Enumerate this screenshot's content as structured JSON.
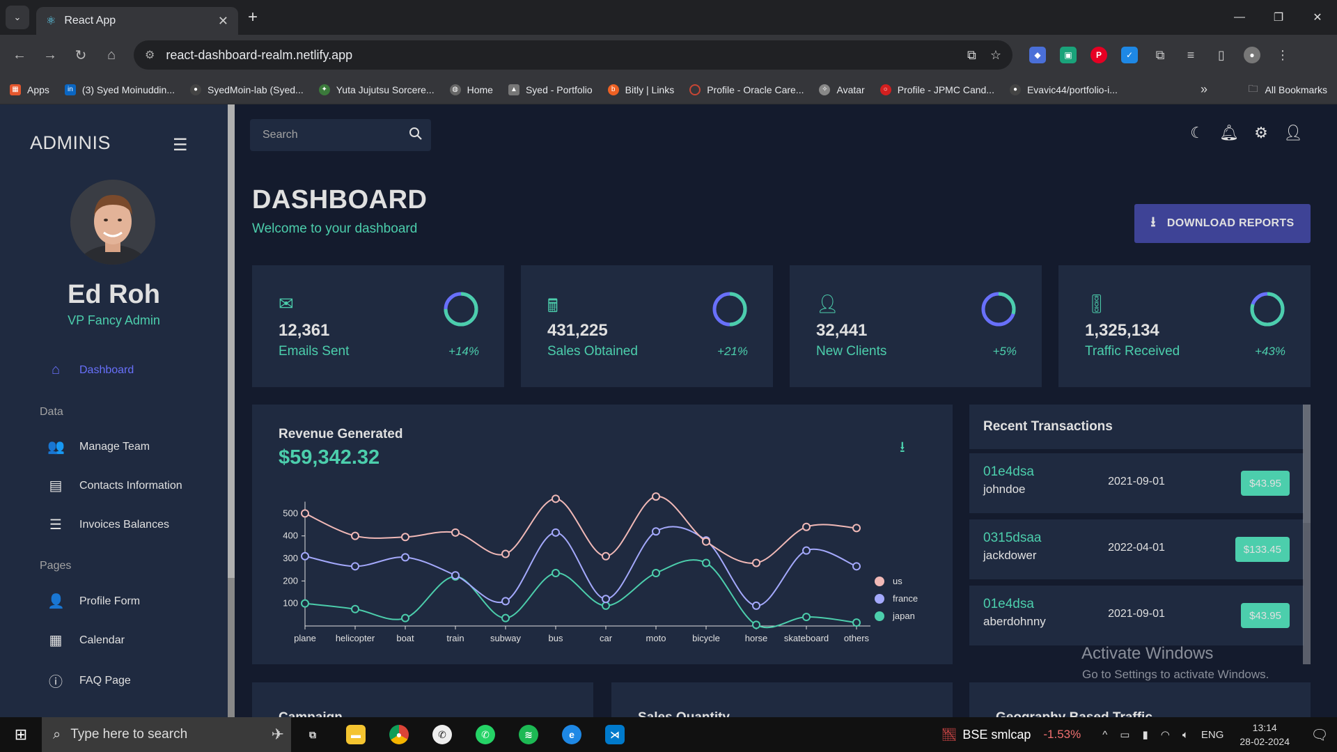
{
  "browser": {
    "tab_title": "React App",
    "url": "react-dashboard-realm.netlify.app",
    "bookmarks": [
      {
        "label": "Apps",
        "color": "#e4572e",
        "icon": "apps-grid-icon"
      },
      {
        "label": "(3) Syed Moinuddin...",
        "color": "#0a66c2",
        "icon": "linkedin-icon"
      },
      {
        "label": "SyedMoin-lab (Syed...",
        "color": "#444444",
        "icon": "github-icon"
      },
      {
        "label": "Yuta Jujutsu Sorcere...",
        "color": "#3b7a3b",
        "icon": "site-icon"
      },
      {
        "label": "Home",
        "color": "#666666",
        "icon": "globe-icon"
      },
      {
        "label": "Syed - Portfolio",
        "color": "#777777",
        "icon": "portfolio-icon"
      },
      {
        "label": "Bitly | Links",
        "color": "#ee6123",
        "icon": "bitly-icon"
      },
      {
        "label": "Profile - Oracle Care...",
        "color": "#c74634",
        "icon": "oracle-icon"
      },
      {
        "label": "Avatar",
        "color": "#888888",
        "icon": "avatar-icon"
      },
      {
        "label": "Profile - JPMC Cand...",
        "color": "#d21f1f",
        "icon": "jpmc-icon"
      },
      {
        "label": "Evavic44/portfolio-i...",
        "color": "#444444",
        "icon": "github-icon"
      }
    ],
    "all_bookmarks": "All Bookmarks"
  },
  "sidebar": {
    "brand": "ADMINIS",
    "user_name": "Ed Roh",
    "user_role": "VP Fancy Admin",
    "items": [
      {
        "label": "Dashboard",
        "icon": "home-icon"
      },
      {
        "section": "Data"
      },
      {
        "label": "Manage Team",
        "icon": "people-icon"
      },
      {
        "label": "Contacts Information",
        "icon": "contacts-icon"
      },
      {
        "label": "Invoices Balances",
        "icon": "receipt-icon"
      },
      {
        "section": "Pages"
      },
      {
        "label": "Profile Form",
        "icon": "person-icon"
      },
      {
        "label": "Calendar",
        "icon": "calendar-icon"
      },
      {
        "label": "FAQ Page",
        "icon": "help-icon"
      }
    ]
  },
  "topbar": {
    "search_placeholder": "Search"
  },
  "header": {
    "title": "DASHBOARD",
    "subtitle": "Welcome to your dashboard",
    "download_label": "DOWNLOAD REPORTS"
  },
  "stats": [
    {
      "value": "12,361",
      "label": "Emails Sent",
      "increase": "+14%",
      "progress": 0.75,
      "icon": "email-icon"
    },
    {
      "value": "431,225",
      "label": "Sales Obtained",
      "increase": "+21%",
      "progress": 0.5,
      "icon": "point-of-sale-icon"
    },
    {
      "value": "32,441",
      "label": "New Clients",
      "increase": "+5%",
      "progress": 0.3,
      "icon": "person-add-icon"
    },
    {
      "value": "1,325,134",
      "label": "Traffic Received",
      "increase": "+43%",
      "progress": 0.8,
      "icon": "traffic-icon"
    }
  ],
  "revenue": {
    "title": "Revenue Generated",
    "amount": "$59,342.32"
  },
  "chart_data": {
    "type": "line",
    "categories": [
      "plane",
      "helicopter",
      "boat",
      "train",
      "subway",
      "bus",
      "car",
      "moto",
      "bicycle",
      "horse",
      "skateboard",
      "others"
    ],
    "series": [
      {
        "name": "us",
        "color": "#f1b9b7",
        "values": [
          500,
          400,
          395,
          415,
          320,
          565,
          310,
          575,
          375,
          280,
          440,
          435
        ]
      },
      {
        "name": "france",
        "color": "#a4a9fc",
        "values": [
          310,
          265,
          305,
          225,
          110,
          415,
          120,
          420,
          380,
          90,
          335,
          265
        ]
      },
      {
        "name": "japan",
        "color": "#4cceac",
        "values": [
          100,
          75,
          35,
          220,
          35,
          235,
          90,
          235,
          280,
          5,
          40,
          15
        ]
      }
    ],
    "yticks": [
      100,
      200,
      300,
      400,
      500
    ],
    "ylim": [
      0,
      600
    ],
    "legend_position": "right"
  },
  "transactions": {
    "title": "Recent Transactions",
    "rows": [
      {
        "txId": "01e4dsa",
        "user": "johndoe",
        "date": "2021-09-01",
        "cost": "$43.95"
      },
      {
        "txId": "0315dsaa",
        "user": "jackdower",
        "date": "2022-04-01",
        "cost": "$133.45"
      },
      {
        "txId": "01e4dsa",
        "user": "aberdohnny",
        "date": "2021-09-01",
        "cost": "$43.95"
      }
    ]
  },
  "bottom_cards": [
    "Campaign",
    "Sales Quantity",
    "Geography Based Traffic"
  ],
  "watermark": {
    "line1": "Activate Windows",
    "line2": "Go to Settings to activate Windows."
  },
  "taskbar": {
    "search_placeholder": "Type here to search",
    "ticker_name": "BSE smlcap",
    "ticker_value": "-1.53%",
    "lang": "ENG",
    "time": "13:14",
    "date": "28-02-2024"
  }
}
